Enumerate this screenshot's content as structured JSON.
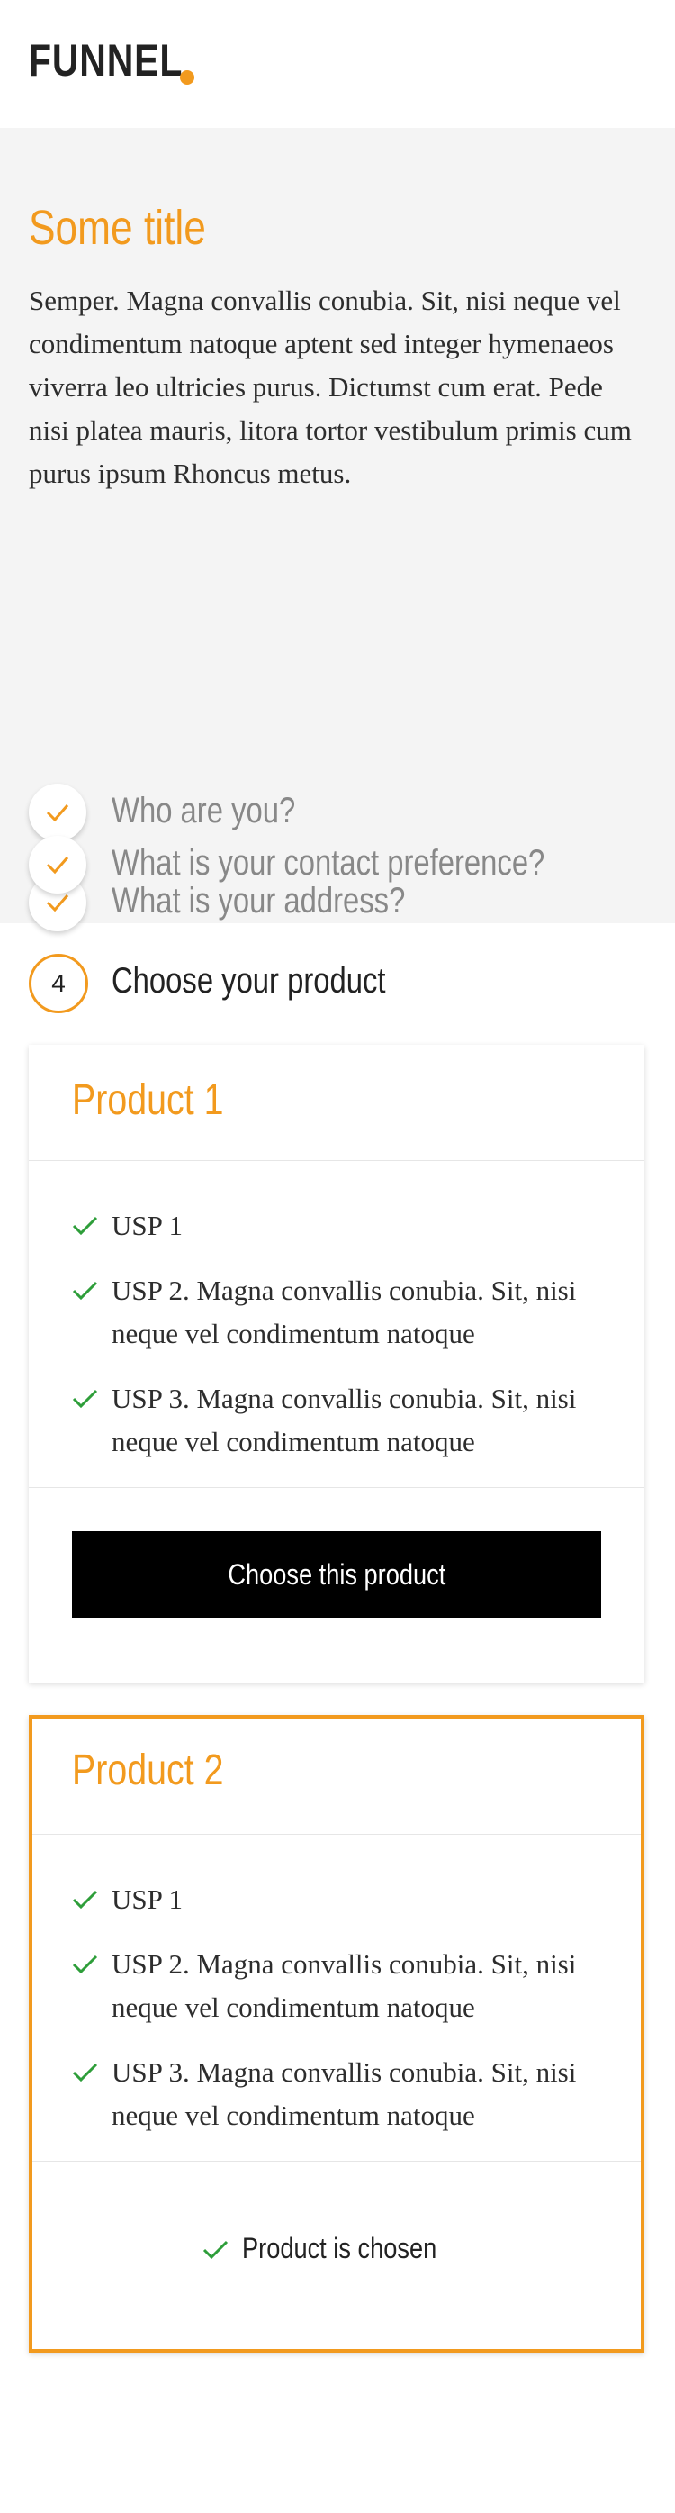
{
  "header": {
    "logo_text": "FUNNEL",
    "accent_color": "#f29a1e"
  },
  "intro": {
    "title": "Some title",
    "text": "Semper. Magna convallis conubia. Sit, nisi neque vel condimentum natoque aptent sed integer hymenaeos viverra leo ultricies purus. Dictumst cum erat. Pede nisi platea mauris, litora tortor vestibulum primis cum purus ipsum Rhoncus metus."
  },
  "completed_steps": [
    {
      "label": "Who are you?",
      "icon": "check-icon"
    },
    {
      "label": "What is your address?",
      "icon": "check-icon"
    },
    {
      "label": "What is your contact preference?",
      "icon": "check-icon"
    }
  ],
  "active_step": {
    "number": "4",
    "label": "Choose your product"
  },
  "products": [
    {
      "title": "Product 1",
      "usps": [
        "USP 1",
        "USP 2. Magna convallis conubia. Sit, nisi neque vel condimentum natoque",
        "USP 3. Magna convallis conubia. Sit, nisi neque vel condimentum natoque"
      ],
      "button_label": "Choose this product",
      "chosen": false
    },
    {
      "title": "Product 2",
      "usps": [
        "USP 1",
        "USP 2. Magna convallis conubia. Sit, nisi neque vel condimentum natoque",
        "USP 3. Magna convallis conubia. Sit, nisi neque vel condimentum natoque"
      ],
      "status_label": "Product is chosen",
      "chosen": true
    }
  ],
  "colors": {
    "accent": "#f29a1e",
    "check_green": "#2e9e3a",
    "button_bg": "#000000"
  }
}
